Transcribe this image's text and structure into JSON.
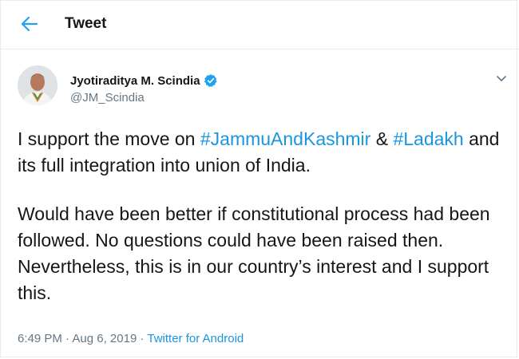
{
  "header": {
    "title": "Tweet",
    "back_icon": "arrow-left-icon"
  },
  "tweet": {
    "author": {
      "name": "Jyotiraditya M. Scindia",
      "handle": "@JM_Scindia",
      "verified": true
    },
    "paragraph1": {
      "part1": "I support the move on ",
      "hashtag1": "#JammuAndKashmir",
      "part2": " & ",
      "hashtag2": "#Ladakh",
      "part3": " and its full integration into union of India."
    },
    "paragraph2": "Would have been better if constitutional process had been followed. No questions could have been raised then. Nevertheless, this is in our country’s interest and I support this.",
    "time": "6:49 PM",
    "separator": " · ",
    "date": "Aug 6, 2019",
    "source": "Twitter for Android"
  },
  "colors": {
    "accent": "#1da1f2",
    "link": "#1b95e0",
    "secondary_text": "#657786",
    "border": "#e6ecf0"
  }
}
